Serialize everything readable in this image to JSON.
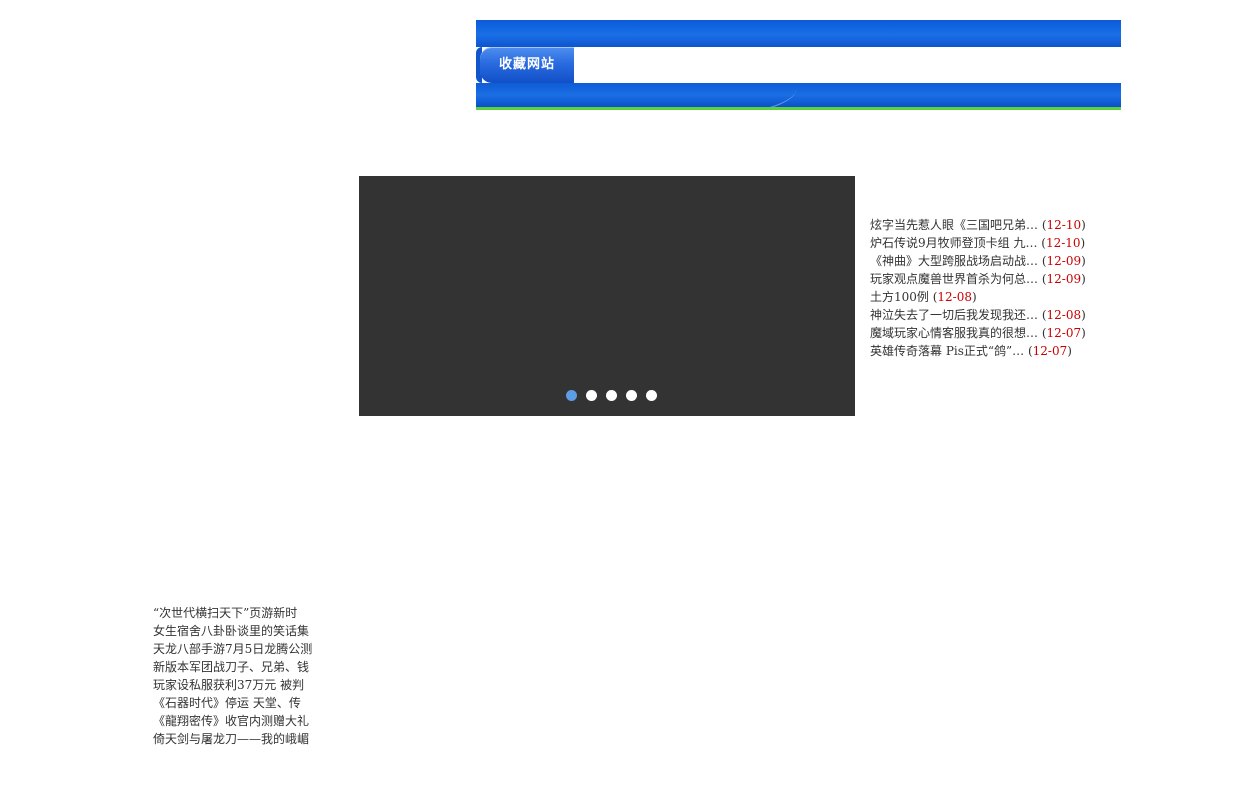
{
  "banner": {
    "bookmark_label": "收藏网站"
  },
  "slideshow": {
    "dot_count": 5,
    "active_index": 0
  },
  "news": {
    "items": [
      {
        "title": "炫字当先惹人眼《三国吧兄弟…",
        "date": "12-10"
      },
      {
        "title": "炉石传说9月牧师登顶卡组 九…",
        "date": "12-10"
      },
      {
        "title": "《神曲》大型跨服战场启动战…",
        "date": "12-09"
      },
      {
        "title": "玩家观点魔兽世界首杀为何总…",
        "date": "12-09"
      },
      {
        "title": "土方100例",
        "date": "12-08"
      },
      {
        "title": "神泣失去了一切后我发现我还…",
        "date": "12-08"
      },
      {
        "title": "魔域玩家心情客服我真的很想…",
        "date": "12-07"
      },
      {
        "title": "英雄传奇落幕 Pis正式“鸽”…",
        "date": "12-07"
      }
    ]
  },
  "left_list": {
    "items": [
      "“次世代横扫天下”页游新时",
      "女生宿舍八卦卧谈里的笑话集",
      "天龙八部手游7月5日龙腾公测",
      "新版本军团战刀子、兄弟、钱",
      "玩家设私服获利37万元 被判",
      "《石器时代》停运 天堂、传",
      "《龍翔密传》收官内测赠大礼",
      "倚天剑与屠龙刀——我的峨嵋"
    ]
  },
  "colors": {
    "banner_blue": "#0a5bd9",
    "banner_green": "#5cd13a",
    "slideshow_bg": "#333333",
    "dot_active": "#5b9ee6",
    "date_red": "#cc0000"
  }
}
